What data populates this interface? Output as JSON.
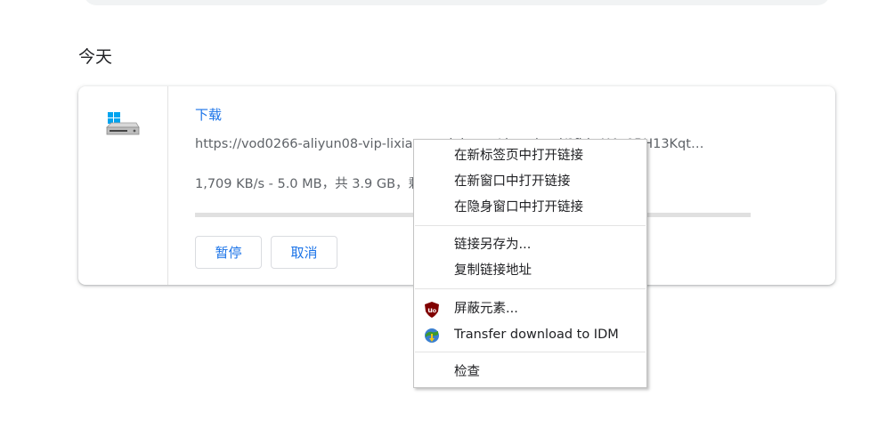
{
  "section": {
    "date_header": "今天"
  },
  "download": {
    "file_name": "下载",
    "url": "https://vod0266-aliyun08-vip-lixian.xunlei.com/download/?fid=X4e0BH13Kqt…",
    "status": "1,709 KB/s - 5.0 MB，共 3.9 GB，剩余 21 分钟",
    "progress": 0.0013,
    "pause_label": "暂停",
    "cancel_label": "取消",
    "icon": "windows-drive-icon"
  },
  "context_menu": {
    "items": [
      {
        "label": "在新标签页中打开链接"
      },
      {
        "label": "在新窗口中打开链接"
      },
      {
        "label": "在隐身窗口中打开链接"
      },
      {
        "label": "链接另存为..."
      },
      {
        "label": "复制链接地址"
      },
      {
        "label": "屏蔽元素...",
        "icon": "ublock-icon"
      },
      {
        "label": "Transfer download to IDM",
        "icon": "idm-icon"
      },
      {
        "label": "检查"
      }
    ]
  },
  "colors": {
    "accent": "#1a73e8",
    "ublock_red": "#800000",
    "idm_green": "#3b9a2e"
  }
}
